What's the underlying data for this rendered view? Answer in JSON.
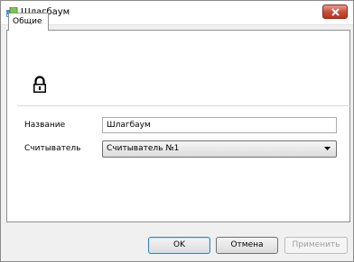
{
  "window": {
    "title": "Шлагбаум",
    "close_label": "×"
  },
  "tabs": [
    {
      "label": "Общие",
      "active": true
    }
  ],
  "form": {
    "name_label": "Название",
    "name_value": "Шлагбаум",
    "reader_label": "Считыватель",
    "reader_value": "Считыватель №1"
  },
  "buttons": {
    "ok": "OK",
    "cancel": "Отмена",
    "apply": "Применить"
  },
  "icons": {
    "app": "barrier-app-icon",
    "main": "padlock-icon"
  },
  "colors": {
    "close_button": "#c84a36",
    "tab_border": "#8e8f8f"
  }
}
